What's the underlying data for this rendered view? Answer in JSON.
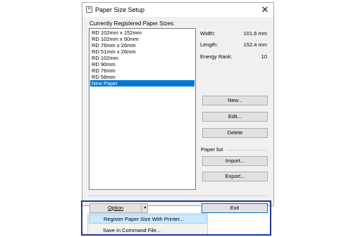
{
  "window": {
    "title": "Paper Size Setup",
    "close_glyph": "✕",
    "app_icon_glyph": "A"
  },
  "list": {
    "label": "Currently Registered Paper Sizes:",
    "items": [
      "RD 102mm x 152mm",
      "RD 102mm x 50mm",
      "RD 76mm x 26mm",
      "RD 51mm x 26mm",
      "RD 102mm",
      "RD 90mm",
      "RD 76mm",
      "RD 58mm",
      "New Paper"
    ],
    "selected_index": 8
  },
  "properties": {
    "width_label": "Width:",
    "width_value": "101.6 mm",
    "length_label": "Length:",
    "length_value": "152.4 mm",
    "energy_label": "Energy Rank:",
    "energy_value": "10"
  },
  "buttons": {
    "new": "New...",
    "edit": "Edit...",
    "delete": "Delete",
    "paper_list_label": "Paper list",
    "import": "Import...",
    "export": "Export...",
    "option": "Option",
    "option_arrow": "▾",
    "exit": "Exit"
  },
  "menu": {
    "items": [
      "Register Paper Size With Printer...",
      "Save in Command File..."
    ],
    "hover_index": 0
  },
  "colors": {
    "selection": "#0078d7",
    "highlight_border": "#1f3a93",
    "menu_hover": "#cce8ff"
  }
}
